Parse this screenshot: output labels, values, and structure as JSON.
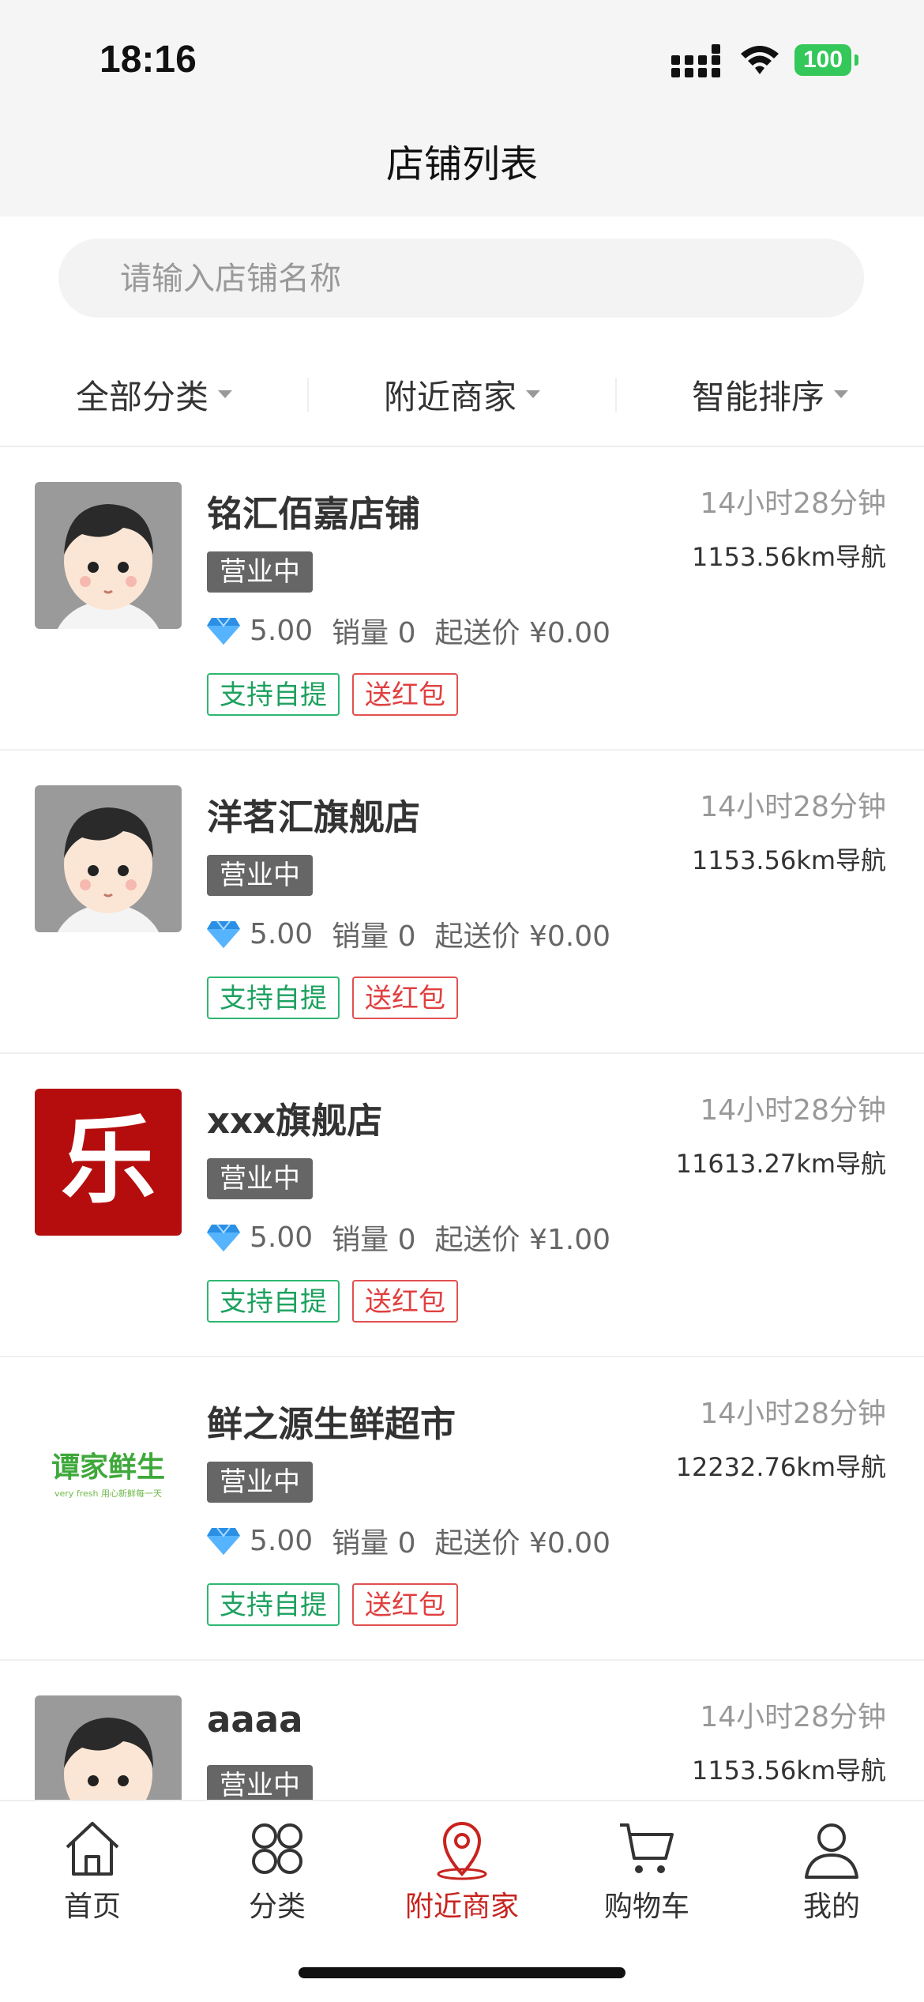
{
  "status_bar": {
    "time": "18:16",
    "battery": "100"
  },
  "nav": {
    "title": "店铺列表"
  },
  "search": {
    "placeholder": "请输入店铺名称"
  },
  "filters": [
    "全部分类",
    "附近商家",
    "智能排序"
  ],
  "stores": [
    {
      "name": "铭汇佰嘉店铺",
      "status": "营业中",
      "rating": "5.00",
      "sales": "销量 0",
      "min_order": "起送价 ¥0.00",
      "tags": [
        "支持自提",
        "送红包"
      ],
      "time": "14小时28分钟",
      "distance": "1153.56km导航",
      "thumb": "avatar"
    },
    {
      "name": "洋茗汇旗舰店",
      "status": "营业中",
      "rating": "5.00",
      "sales": "销量 0",
      "min_order": "起送价 ¥0.00",
      "tags": [
        "支持自提",
        "送红包"
      ],
      "time": "14小时28分钟",
      "distance": "1153.56km导航",
      "thumb": "avatar"
    },
    {
      "name": "xxx旗舰店",
      "status": "营业中",
      "rating": "5.00",
      "sales": "销量 0",
      "min_order": "起送价 ¥1.00",
      "tags": [
        "支持自提",
        "送红包"
      ],
      "time": "14小时28分钟",
      "distance": "11613.27km导航",
      "thumb": "le",
      "thumb_text": "乐"
    },
    {
      "name": "鲜之源生鲜超市",
      "status": "营业中",
      "rating": "5.00",
      "sales": "销量 0",
      "min_order": "起送价 ¥0.00",
      "tags": [
        "支持自提",
        "送红包"
      ],
      "time": "14小时28分钟",
      "distance": "12232.76km导航",
      "thumb": "fresh",
      "thumb_text": "谭家鲜生",
      "thumb_sub": "very fresh 用心新鲜每一天"
    },
    {
      "name": "aaaa",
      "status": "营业中",
      "rating": "",
      "sales": "",
      "min_order": "",
      "tags": [],
      "time": "14小时28分钟",
      "distance": "1153.56km导航",
      "thumb": "avatar"
    }
  ],
  "tabbar": [
    {
      "label": "首页",
      "icon": "home-icon",
      "active": false
    },
    {
      "label": "分类",
      "icon": "category-icon",
      "active": false
    },
    {
      "label": "附近商家",
      "icon": "location-icon",
      "active": true
    },
    {
      "label": "购物车",
      "icon": "cart-icon",
      "active": false
    },
    {
      "label": "我的",
      "icon": "user-icon",
      "active": false
    }
  ],
  "colors": {
    "accent": "#c8231e",
    "status_badge": "#666666",
    "tag_green": "#1da15f",
    "tag_red": "#e04040",
    "battery": "#34c759"
  }
}
